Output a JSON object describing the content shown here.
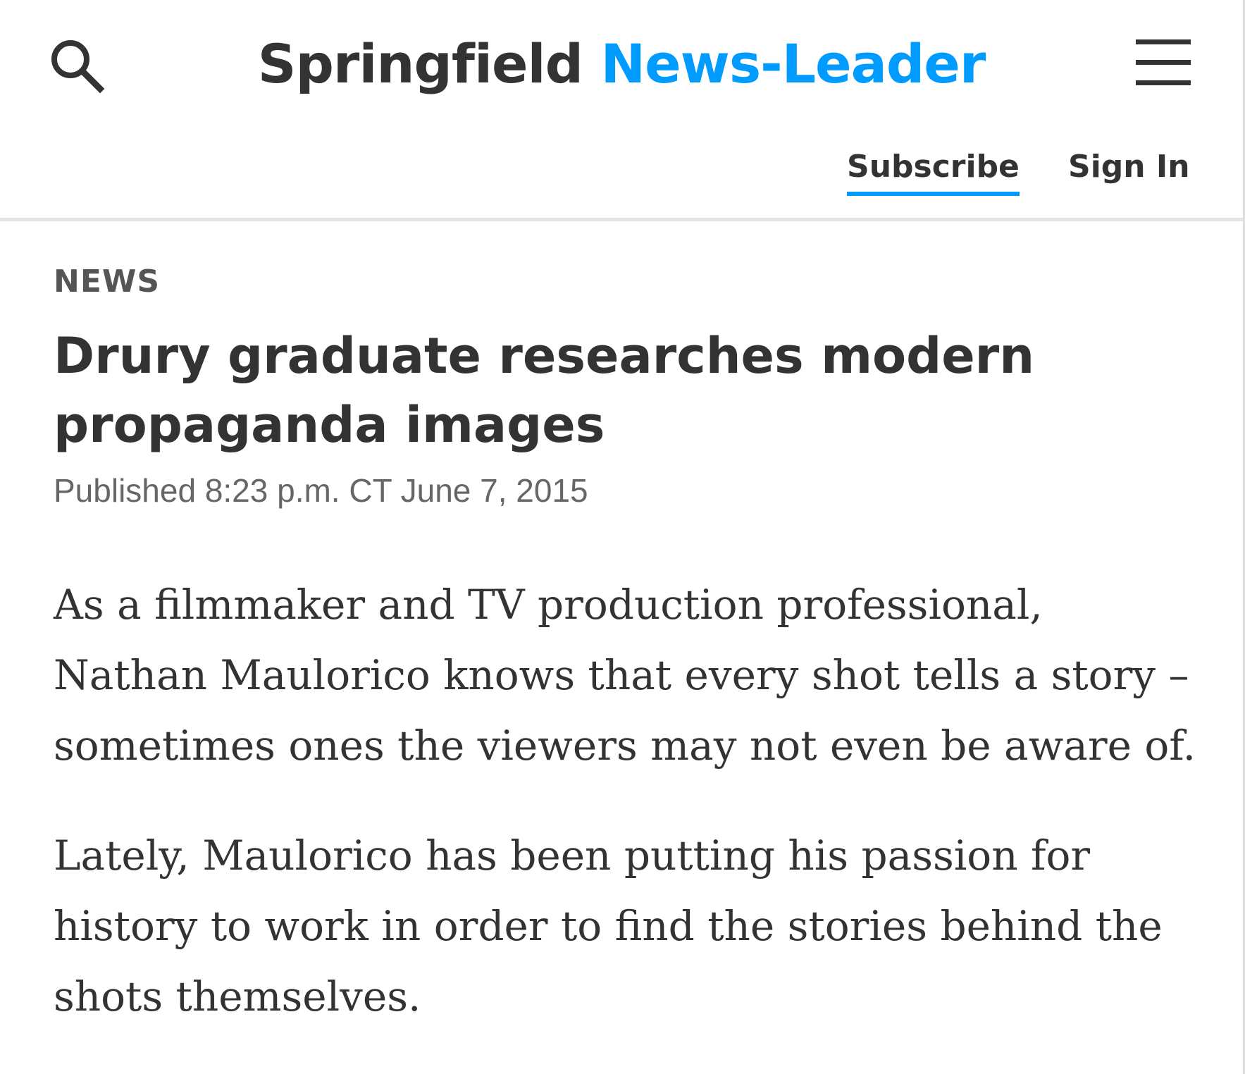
{
  "header": {
    "brand_primary": "Springfield",
    "brand_secondary": "News-Leader",
    "subscribe_label": "Subscribe",
    "signin_label": "Sign In",
    "icons": {
      "search": "search-icon",
      "menu": "menu-icon"
    }
  },
  "article": {
    "section": "NEWS",
    "headline": "Drury graduate researches modern propaganda images",
    "published": "Published 8:23 p.m. CT June 7, 2015",
    "paragraphs": [
      "As a filmmaker and TV production professional, Nathan Maulorico knows that every shot tells a story – sometimes ones the viewers may not even be aware of.",
      "Lately, Maulorico has been putting his passion for history to work in order to find the stories behind the shots themselves."
    ]
  },
  "colors": {
    "accent": "#009bff",
    "text": "#333333",
    "muted": "#666666",
    "divider": "#e4e4e4"
  }
}
